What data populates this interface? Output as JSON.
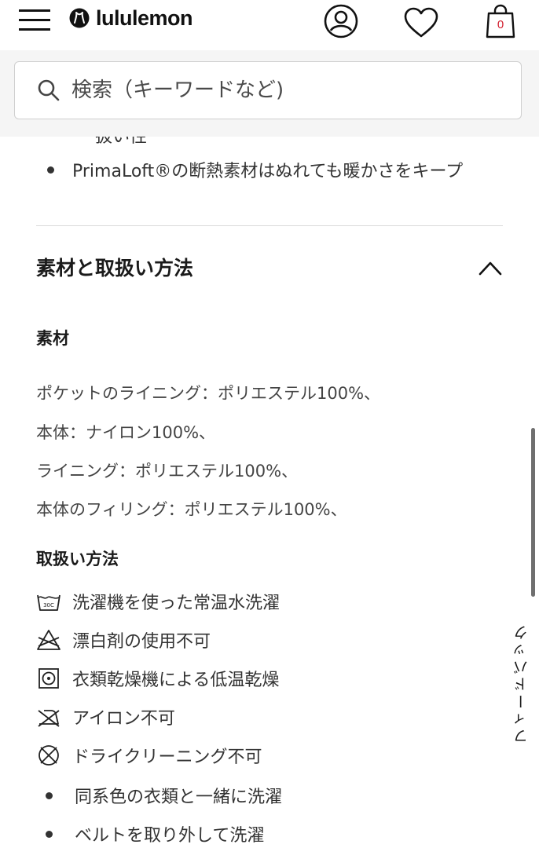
{
  "header": {
    "brand": "lululemon",
    "bag_count": "0"
  },
  "search": {
    "placeholder": "検索（キーワードなど)"
  },
  "features": {
    "cut_off_text": "ー 扱い性",
    "bullet_last": "PrimaLoft®の断熱素材はぬれても暖かさをキープ"
  },
  "materials_care": {
    "title": "素材と取扱い方法",
    "materials_heading": "素材",
    "materials": [
      "ポケットのライニング：ポリエステル100%、",
      "本体：ナイロン100%、",
      "ライニング：ポリエステル100%、",
      "本体のフィリング：ポリエステル100%、"
    ],
    "care_heading": "取扱い方法",
    "care_items": [
      {
        "icon": "wash-30c-icon",
        "label": "洗濯機を使った常温水洗濯"
      },
      {
        "icon": "no-bleach-icon",
        "label": "漂白剤の使用不可"
      },
      {
        "icon": "tumble-dry-low-icon",
        "label": "衣類乾燥機による低温乾燥"
      },
      {
        "icon": "no-iron-icon",
        "label": "アイロン不可"
      },
      {
        "icon": "no-dry-clean-icon",
        "label": "ドライクリーニング不可"
      }
    ],
    "care_bullets": [
      "同系色の衣類と一緒に洗濯",
      "ベルトを取り外して洗濯"
    ]
  },
  "feedback": {
    "label": "フィードバック"
  },
  "colors": {
    "accent_red": "#d22030",
    "text": "#1f1f1f",
    "divider": "#dadada",
    "search_band": "#f5f5f5"
  }
}
